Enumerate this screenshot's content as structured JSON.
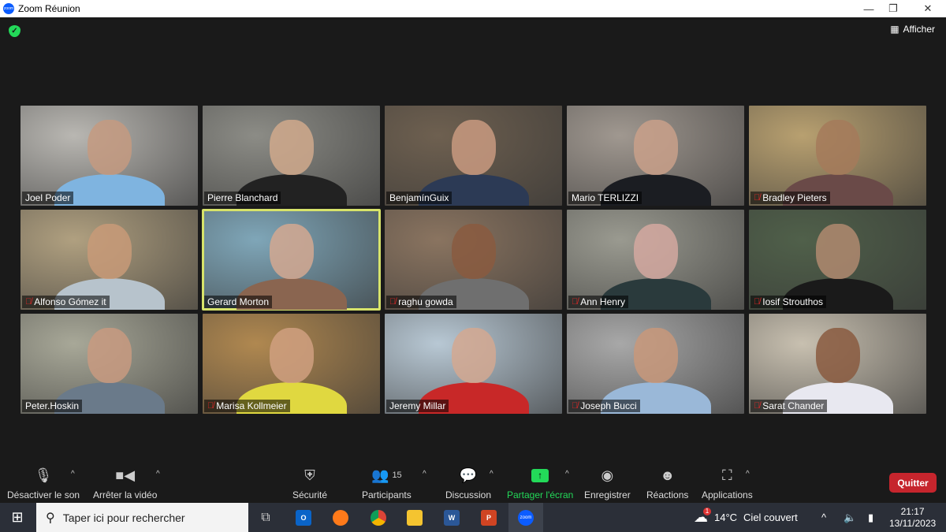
{
  "window": {
    "title": "Zoom Réunion",
    "minimize": "—",
    "maximize": "❐",
    "close": "✕"
  },
  "view_button": "Afficher",
  "participants": [
    {
      "name": "Joel Poder",
      "muted": false,
      "bg": "#b9b7b2",
      "skin": "#c49a80",
      "shirt": "#7fb4e0"
    },
    {
      "name": "Pierre Blanchard",
      "muted": false,
      "bg": "#8c8c86",
      "skin": "#d0a98c",
      "shirt": "#222"
    },
    {
      "name": "BenjamínGuix",
      "muted": false,
      "bg": "#6e6050",
      "skin": "#c99a80",
      "shirt": "#2c3a55"
    },
    {
      "name": "Mario TERLIZZI",
      "muted": false,
      "bg": "#a09890",
      "skin": "#c9a08a",
      "shirt": "#1b1d22"
    },
    {
      "name": "Bradley Pieters",
      "muted": true,
      "bg": "#b8a070",
      "skin": "#a47a5a",
      "shirt": "#6a4a48"
    },
    {
      "name": "Alfonso Gómez it",
      "muted": true,
      "bg": "#b0a080",
      "skin": "#c89a78",
      "shirt": "#b7c3cc"
    },
    {
      "name": "Gerard Morton",
      "muted": false,
      "active": true,
      "bg": "#7fa6b8",
      "skin": "#d4a890",
      "shirt": "#8a6550"
    },
    {
      "name": "raghu gowda",
      "muted": true,
      "bg": "#8a7460",
      "skin": "#8a5a40",
      "shirt": "#6f6f6f"
    },
    {
      "name": "Ann Henry",
      "muted": true,
      "bg": "#9a9a90",
      "skin": "#d4a8a0",
      "shirt": "#2a3a3c"
    },
    {
      "name": "Iosif Strouthos",
      "muted": true,
      "bg": "#50604a",
      "skin": "#b08a70",
      "shirt": "#1a1a1a"
    },
    {
      "name": "Peter.Hoskin",
      "muted": false,
      "bg": "#a8a898",
      "skin": "#c89a80",
      "shirt": "#6a7a8a"
    },
    {
      "name": "Marisa Kollmeier",
      "muted": true,
      "bg": "#b08850",
      "skin": "#d0a080",
      "shirt": "#e0d840"
    },
    {
      "name": "Jeremy Millar",
      "muted": false,
      "bg": "#b8c8d4",
      "skin": "#d4a890",
      "shirt": "#c82828"
    },
    {
      "name": "Joseph Bucci",
      "muted": true,
      "bg": "#a8a8a8",
      "skin": "#c8987a",
      "shirt": "#9ab8d8"
    },
    {
      "name": "Sarat Chander",
      "muted": true,
      "bg": "#c8c0b0",
      "skin": "#8a5a40",
      "shirt": "#e8e8f0"
    }
  ],
  "controls": {
    "mute": "Désactiver le son",
    "video": "Arrêter la vidéo",
    "security": "Sécurité",
    "participants": "Participants",
    "participant_count": "15",
    "chat": "Discussion",
    "share": "Partager l'écran",
    "record": "Enregistrer",
    "reactions": "Réactions",
    "apps": "Applications",
    "quit": "Quitter"
  },
  "taskbar": {
    "search_placeholder": "Taper ici pour rechercher",
    "weather_temp": "14°C",
    "weather_desc": "Ciel couvert",
    "weather_badge": "1",
    "time": "21:17",
    "date": "13/11/2023",
    "zoom_app": "zoom"
  },
  "colors": {
    "accent_green": "#23d959",
    "quit_red": "#c6252d",
    "active_speaker": "#d7e36a"
  }
}
